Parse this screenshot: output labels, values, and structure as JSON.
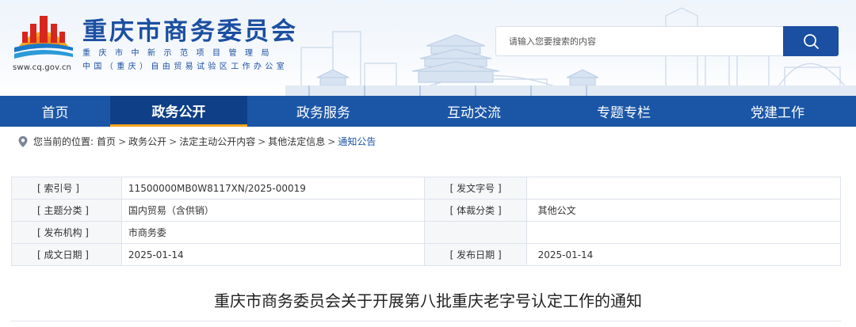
{
  "header": {
    "site_title": "重庆市商务委员会",
    "subtitle_line1": "重庆市中新示范项目管理局",
    "subtitle_line2": "中国（重庆）自由贸易试验区工作办公室",
    "domain": "sww.cq.gov.cn"
  },
  "search": {
    "placeholder": "请输入您要搜索的内容",
    "icon": "search-icon"
  },
  "nav": {
    "items": [
      {
        "label": "首页"
      },
      {
        "label": "政务公开",
        "active": true
      },
      {
        "label": "政务服务"
      },
      {
        "label": "互动交流"
      },
      {
        "label": "专题专栏"
      },
      {
        "label": "党建工作"
      }
    ]
  },
  "breadcrumb": {
    "prefix": "您当前的位置:",
    "items": [
      "首页",
      "政务公开",
      "法定主动公开内容",
      "其他法定信息",
      "通知公告"
    ]
  },
  "meta": {
    "rows": [
      {
        "label1": "[ 索引号 ]",
        "value1": "11500000MB0W8117XN/2025-00019",
        "label2": "[ 发文字号 ]",
        "value2": ""
      },
      {
        "label1": "[ 主题分类 ]",
        "value1": "国内贸易（含供销）",
        "label2": "[ 体裁分类 ]",
        "value2": "其他公文"
      },
      {
        "label1": "[ 发布机构 ]",
        "value1": "市商务委",
        "label2": "",
        "value2": ""
      },
      {
        "label1": "[ 成文日期 ]",
        "value1": "2025-01-14",
        "label2": "[ 发布日期 ]",
        "value2": "2025-01-14"
      }
    ]
  },
  "document": {
    "title": "重庆市商务委员会关于开展第八批重庆老字号认定工作的通知"
  },
  "colors": {
    "brand_blue": "#1b4fa1",
    "nav_blue": "#1b56a6",
    "nav_active": "#0f3f86",
    "accent_orange": "#f3a31c"
  }
}
